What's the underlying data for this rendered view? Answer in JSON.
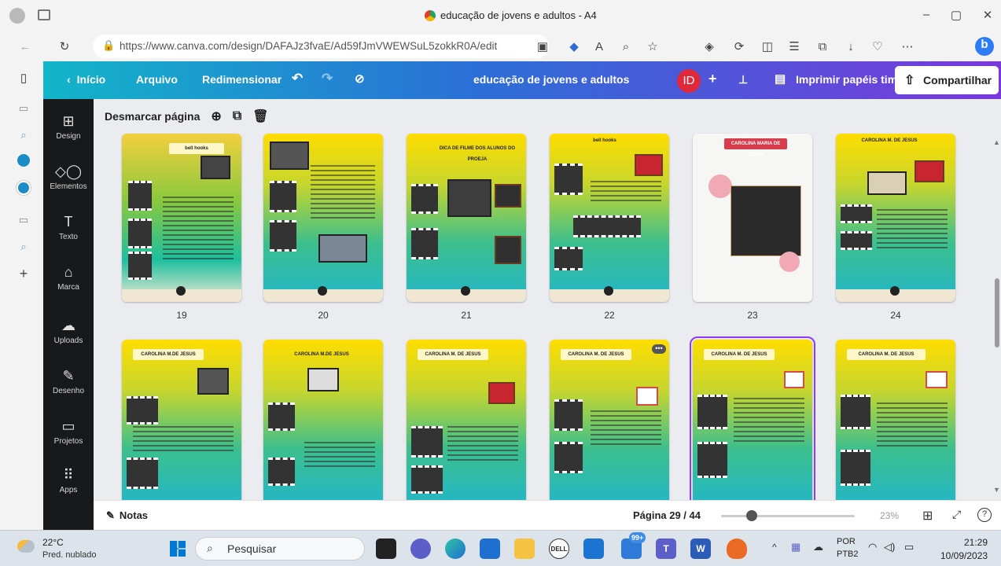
{
  "window": {
    "title": "educação de jovens e adultos - A4"
  },
  "browser": {
    "url": "https://www.canva.com/design/DAFAJz3fvaE/Ad59fJmVWEWSuL5zokkR0A/edit"
  },
  "canva_header": {
    "back_label": "Início",
    "file_label": "Arquivo",
    "resize_label": "Redimensionar",
    "design_title": "educação de jovens e adultos",
    "avatar_initials": "ID",
    "print_label": "Imprimir papéis timbrados",
    "share_label": "Compartilhar"
  },
  "sidebar": {
    "items": [
      {
        "label": "Design",
        "icon": "layout-icon"
      },
      {
        "label": "Elementos",
        "icon": "shapes-icon"
      },
      {
        "label": "Texto",
        "icon": "text-icon"
      },
      {
        "label": "Marca",
        "icon": "brand-icon"
      },
      {
        "label": "Uploads",
        "icon": "cloud-upload-icon"
      },
      {
        "label": "Desenho",
        "icon": "draw-icon"
      },
      {
        "label": "Projetos",
        "icon": "folder-icon"
      },
      {
        "label": "Apps",
        "icon": "apps-grid-icon"
      }
    ]
  },
  "page_toolbar": {
    "deselect_label": "Desmarcar página"
  },
  "thumbnails": {
    "row1": [
      {
        "num": "19",
        "header": "bell hooks"
      },
      {
        "num": "20",
        "header": ""
      },
      {
        "num": "21",
        "header": "DICA DE FILME DOS ALUNOS DO PROEJA"
      },
      {
        "num": "22",
        "header": "bell hooks"
      },
      {
        "num": "23",
        "header": "CAROLINA MARIA DE JESUS"
      },
      {
        "num": "24",
        "header": "CAROLINA M. DE JESUS"
      }
    ],
    "row2": [
      {
        "header": "CAROLINA M.DE JESUS"
      },
      {
        "header": "CAROLINA M.DE JESUS"
      },
      {
        "header": "CAROLINA M. DE JESUS"
      },
      {
        "header": "CAROLINA M. DE JESUS"
      },
      {
        "header": "CAROLINA M. DE JESUS"
      },
      {
        "header": "CAROLINA M. DE JESUS"
      }
    ]
  },
  "bottom_bar": {
    "notes_label": "Notas",
    "page_indicator": "Página 29 / 44",
    "zoom": "23%",
    "help": "?"
  },
  "taskbar": {
    "weather_temp": "22°C",
    "weather_desc": "Pred. nublado",
    "search_placeholder": "Pesquisar",
    "badge": "99+",
    "lang_top": "POR",
    "lang_bottom": "PTB2",
    "time": "21:29",
    "date": "10/09/2023"
  },
  "colors": {
    "canva_gradient_start": "#12b5c9",
    "canva_gradient_end": "#7a38dc",
    "avatar_red": "#e0283a",
    "selected_outline": "#8b3dff"
  }
}
